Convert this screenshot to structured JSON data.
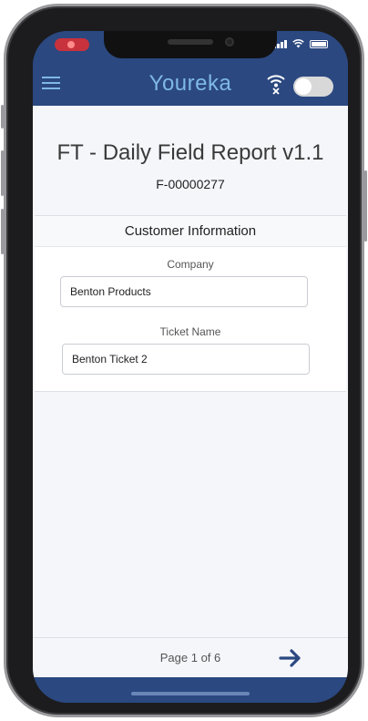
{
  "app": {
    "brand": "Youreka",
    "accent_color": "#2b4880",
    "brand_color": "#7fb8e8"
  },
  "status_bar": {
    "icons": [
      "record-indicator-icon",
      "signal-icon",
      "wifi-icon",
      "battery-icon"
    ]
  },
  "header": {
    "menu_icon": "hamburger-menu-icon",
    "offline_icon": "wifi-off-icon",
    "toggle_state": "off"
  },
  "form": {
    "title": "FT - Daily Field Report v1.1",
    "id": "F-00000277"
  },
  "section": {
    "title": "Customer Information",
    "fields": [
      {
        "label": "Company",
        "value": "Benton Products"
      },
      {
        "label": "Ticket Name",
        "value": "Benton Ticket 2"
      }
    ]
  },
  "footer": {
    "page_indicator": "Page 1 of 6",
    "next_icon": "arrow-right-icon"
  }
}
